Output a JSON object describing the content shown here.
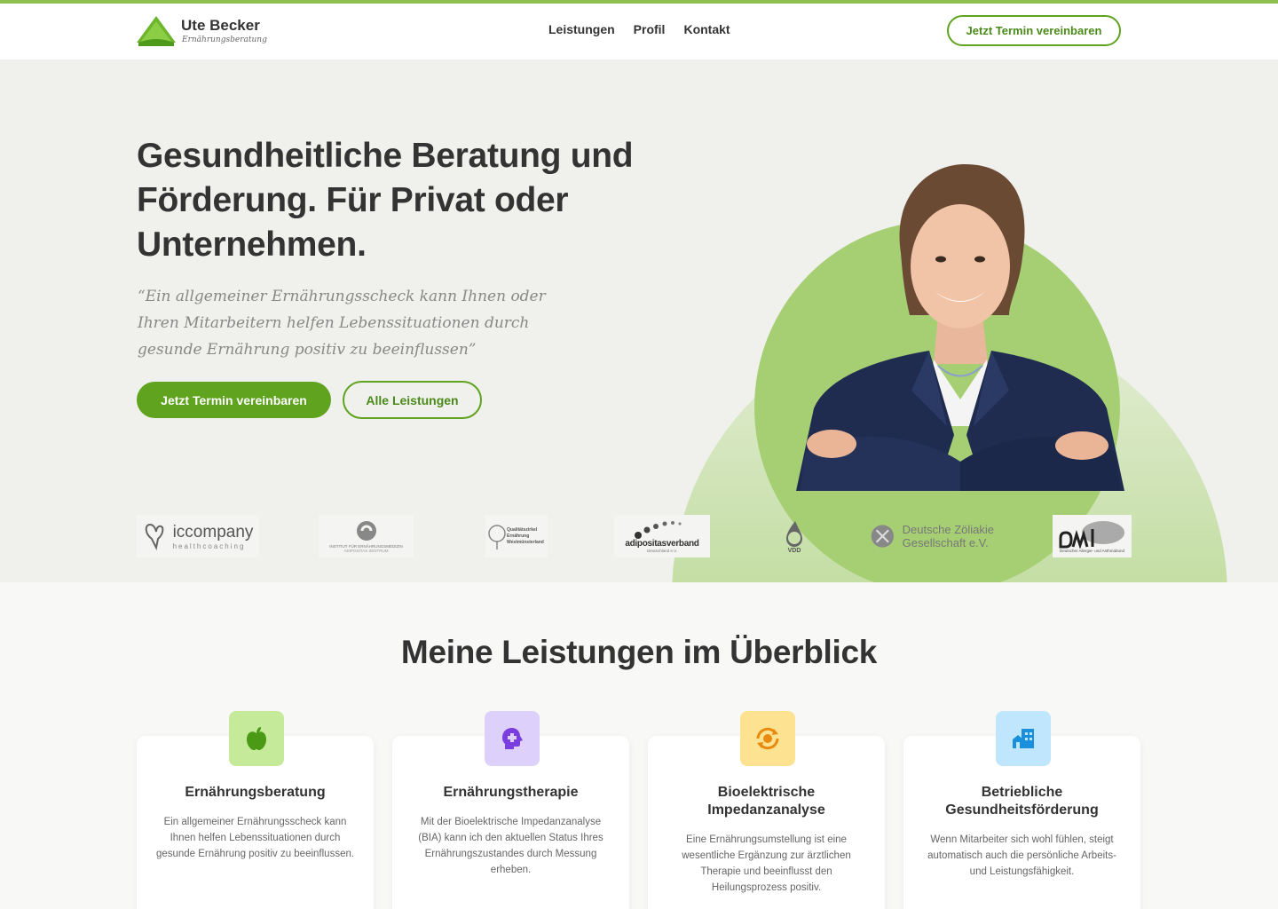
{
  "brand": {
    "name": "Ute Becker",
    "tagline": "Ernährungsberatung",
    "accent": "#5fa31f"
  },
  "nav": {
    "items": [
      "Leistungen",
      "Profil",
      "Kontakt"
    ],
    "cta": "Jetzt Termin vereinbaren"
  },
  "hero": {
    "headline": "Gesundheitliche Beratung und Förderung. Für Privat oder Unternehmen.",
    "quote": "“Ein allgemeiner Ernährungsscheck kann Ihnen oder Ihren Mitarbeitern helfen Lebenssituationen durch gesunde Ernährung positiv zu beeinflussen”",
    "primary_button": "Jetzt Termin vereinbaren",
    "secondary_button": "Alle Leistungen"
  },
  "partners": [
    {
      "name": "iccompany",
      "sub": "healthcoaching"
    },
    {
      "name": "INSTITUT FÜR ERNÄHRUNGSMEDIZIN",
      "sub": "ADIPOSITAS ZENTRUM"
    },
    {
      "name": "Qualitätszirkel Ernährung Westmünsterland"
    },
    {
      "name": "adipositasverband",
      "sub": "Deutschland e.V."
    },
    {
      "name": "VDD"
    },
    {
      "name": "Deutsche Zöliakie",
      "sub": "Gesellschaft e.V."
    },
    {
      "name": "Deutscher Allergie- und Asthmabund"
    }
  ],
  "services": {
    "title": "Meine Leistungen im Überblick",
    "cards": [
      {
        "title": "Ernährungsberatung",
        "text": "Ein allgemeiner Ernährungsscheck kann Ihnen helfen Lebenssituationen durch gesunde Ernährung positiv zu beeinflussen.",
        "icon": "apple-icon",
        "color": "#c5eb9a"
      },
      {
        "title": "Ernährungstherapie",
        "text": "Mit der Bioelektrische Impedanzanalyse (BIA) kann ich den aktuellen Status Ihres Ernährungszustandes durch Messung erheben.",
        "icon": "head-plus-icon",
        "color": "#ddd0fb"
      },
      {
        "title": "Bioelektrische Impedanzanalyse",
        "text": "Eine Ernährungsumstellung ist eine wesentliche Ergänzung zur ärztlichen Therapie und beeinflusst den Heilungsprozess positiv.",
        "icon": "cycle-icon",
        "color": "#fde291"
      },
      {
        "title": "Betriebliche Gesundheitsförderung",
        "text": "Wenn Mitarbeiter sich wohl fühlen, steigt automatisch auch die persönliche Arbeits- und Leistungsfähigkeit.",
        "icon": "building-icon",
        "color": "#bfe6fc"
      }
    ]
  }
}
